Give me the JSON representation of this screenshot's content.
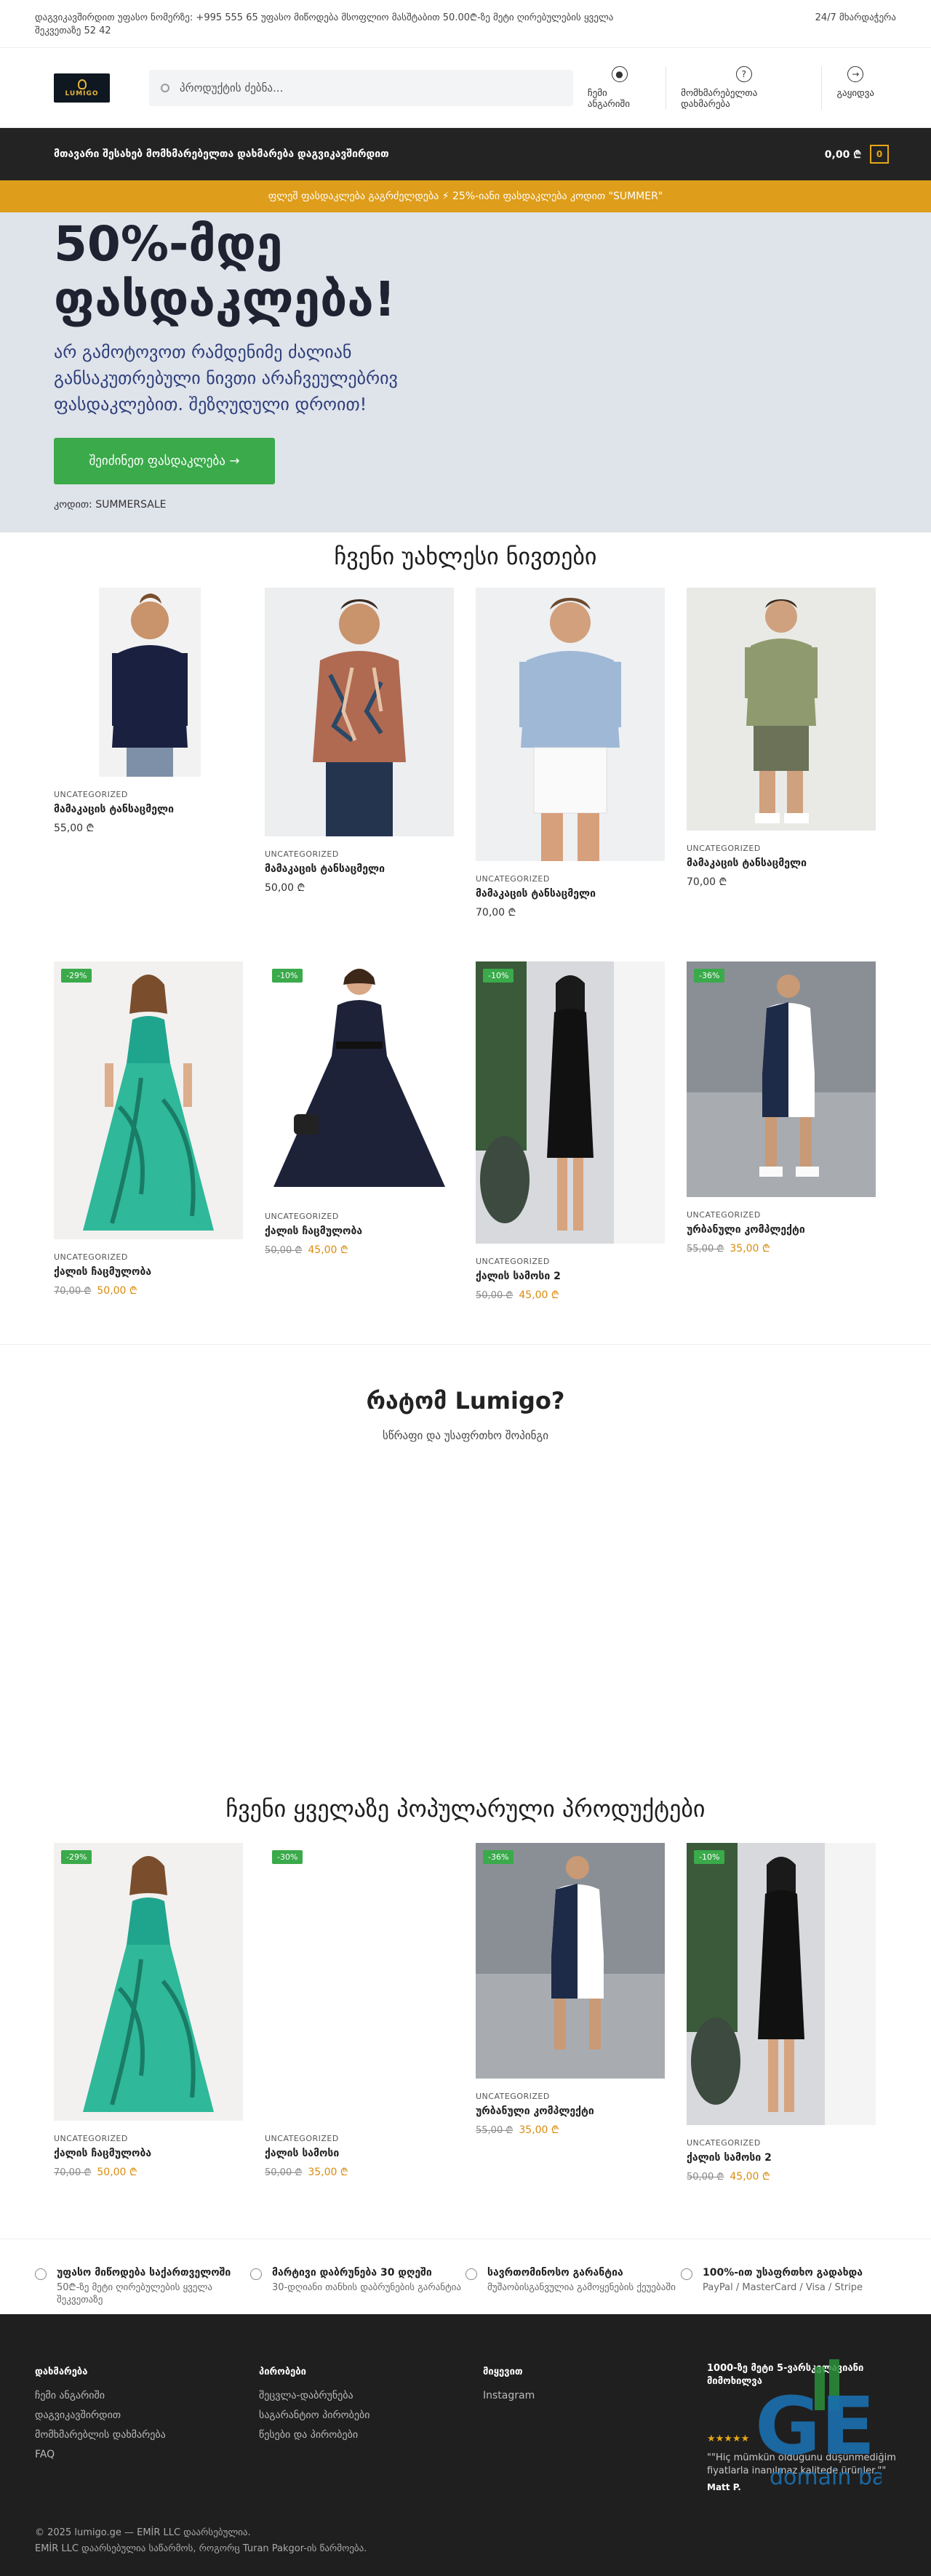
{
  "topbar": {
    "left": "დაგვიკავშირდით უფასო ნომერზე: +995 555 65 უფასო მიწოდება მსოფლიო მასშტაბით 50.00₾-ზე მეტი ღირებულების ყველა შეკვეთაზე 52 42",
    "right": "24/7 მხარდაჭერა"
  },
  "header": {
    "logo": "LUMIGO",
    "search_placeholder": "პროდუქტის ძებნა...",
    "nav": [
      {
        "label": "ჩემი ანგარიში",
        "icon": "user-icon"
      },
      {
        "label": "მომხმარებელთა დახმარება",
        "icon": "help-icon"
      },
      {
        "label": "გაყიდვა",
        "icon": "arrow-right-icon"
      }
    ]
  },
  "nav": {
    "menu": "მთავარი შესახებ მომხმარებელთა დახმარება დაგვიკავშირდით",
    "cart_total": "0,00 ₾",
    "cart_count": "0"
  },
  "promo": "ფლეშ ფასდაკლება გაგრძელდება ⚡ 25%-იანი ფასდაკლება კოდით \"SUMMER\"",
  "hero": {
    "title": "50%-მდე ფასდაკლება!",
    "text": "არ გამოტოვოთ რამდენიმე ძალიან განსაკუთრებული ნივთი არაჩვეულებრივ ფასდაკლებით. შეზღუდული დროით!",
    "button": "შეიძინეთ ფასდაკლება →",
    "coupon": "კოდით: SUMMERSALE"
  },
  "new_section": {
    "title": "ჩვენი უახლესი ნივთები"
  },
  "row1": [
    {
      "cat": "UNCATEGORIZED",
      "name": "მამაკაცის ტანსაცმელი",
      "price": "55,00 ₾"
    },
    {
      "cat": "UNCATEGORIZED",
      "name": "მამაკაცის ტანსაცმელი",
      "price": "50,00 ₾"
    },
    {
      "cat": "UNCATEGORIZED",
      "name": "მამაკაცის ტანსაცმელი",
      "price": "70,00 ₾"
    },
    {
      "cat": "UNCATEGORIZED",
      "name": "მამაკაცის ტანსაცმელი",
      "price": "70,00 ₾"
    }
  ],
  "row2": [
    {
      "badge": "-29%",
      "cat": "UNCATEGORIZED",
      "name": "ქალის ჩაცმულობა",
      "old": "70,00 ₾",
      "price": "50,00 ₾"
    },
    {
      "badge": "-10%",
      "cat": "UNCATEGORIZED",
      "name": "ქალის ჩაცმულობა",
      "old": "50,00 ₾",
      "price": "45,00 ₾"
    },
    {
      "badge": "-10%",
      "cat": "UNCATEGORIZED",
      "name": "ქალის სამოსი 2",
      "old": "50,00 ₾",
      "price": "45,00 ₾"
    },
    {
      "badge": "-36%",
      "cat": "UNCATEGORIZED",
      "name": "ურბანული კომპლექტი",
      "old": "55,00 ₾",
      "price": "35,00 ₾"
    }
  ],
  "why": {
    "title": "რატომ Lumigo?",
    "subtitle": "სწრაფი და უსაფრთხო შოპინგი"
  },
  "popular": {
    "title": "ჩვენი ყველაზე პოპულარული პროდუქტები"
  },
  "row3": [
    {
      "badge": "-29%",
      "cat": "UNCATEGORIZED",
      "name": "ქალის ჩაცმულობა",
      "old": "70,00 ₾",
      "price": "50,00 ₾"
    },
    {
      "badge": "-30%",
      "cat": "UNCATEGORIZED",
      "name": "ქალის სამოსი",
      "old": "50,00 ₾",
      "price": "35,00 ₾"
    },
    {
      "badge": "-36%",
      "cat": "UNCATEGORIZED",
      "name": "ურბანული კომპლექტი",
      "old": "55,00 ₾",
      "price": "35,00 ₾"
    },
    {
      "badge": "-10%",
      "cat": "UNCATEGORIZED",
      "name": "ქალის სამოსი 2",
      "old": "50,00 ₾",
      "price": "45,00 ₾"
    }
  ],
  "features": [
    {
      "title": "უფასო მიწოდება საქართველოში",
      "text": "50₾-ზე მეტი ღირებულების ყველა შეკვეთაზე",
      "icon": "pin-icon"
    },
    {
      "title": "მარტივი დაბრუნება 30 დღეში",
      "text": "30-დღიანი თანხის დაბრუნების გარანტია",
      "icon": "return-icon"
    },
    {
      "title": "სავრთომინოსო გარანტია",
      "text": "მუშაობისგანვულია გამოყენების ქეუებაში",
      "icon": "shield-icon"
    },
    {
      "title": "100%-ით უსაფრთხო გადახდა",
      "text": "PayPal / MasterCard / Visa / Stripe",
      "icon": "lock-icon"
    }
  ],
  "footer": {
    "col1": {
      "title": "დახმარება",
      "links": [
        "ჩემი ანგარიში",
        "დაგვიკავშირდით",
        "მომხმარებლის დახმარება",
        "FAQ"
      ]
    },
    "col2": {
      "title": "პირობები",
      "links": [
        "შეცვლა-დაბრუნება",
        "საგარანტიო პირობები",
        "წესები და პირობები"
      ]
    },
    "col3": {
      "title": "მიყევით",
      "links": [
        "Instagram"
      ]
    },
    "col4": {
      "title": "1000-ზე მეტი 5-ვარსკვლავიანი მიმოხილვა",
      "stars": "★★★★★",
      "quote": "\"\"Hiç mümkün olduğunu düşünmediğim fiyatlarla inanılmaz kalitede ürünler.\"\"",
      "author": "Matt P."
    },
    "copy1": "© 2025 lumigo.ge — EMİR LLC დაარსებულია.",
    "copy2": "EMİR LLC დაარსებულია საწარმოს, როგორც Turan Pakgor-ის წარმოება."
  },
  "watermark": {
    "big": "GE",
    "small": "domain base"
  }
}
